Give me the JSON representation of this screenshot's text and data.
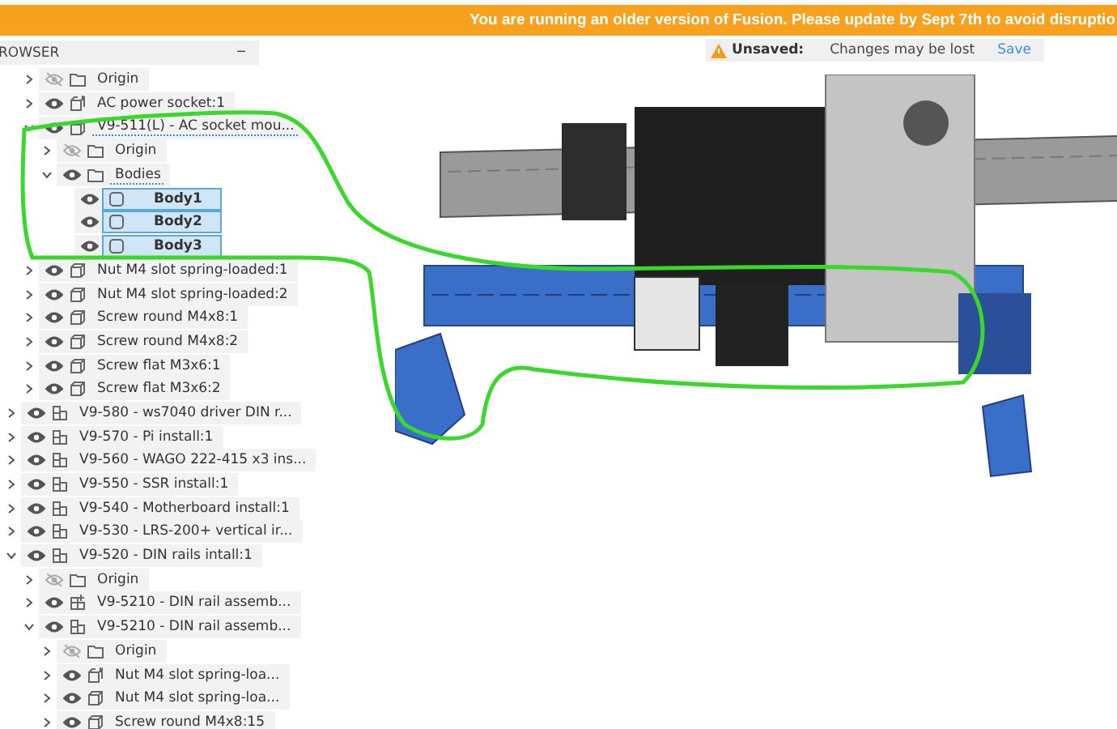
{
  "banner": {
    "text": "You are running an older version of Fusion. Please update by Sept 7th to avoid disruptio"
  },
  "save_status": {
    "label": "Unsaved:",
    "message": "Changes may be lost",
    "action": "Save"
  },
  "browser": {
    "title": "ROWSER",
    "collapse": "−",
    "nested_items": [
      {
        "label": "Origin",
        "kind": "folder",
        "visible": false,
        "expanded": false,
        "selected": false,
        "active": false
      },
      {
        "label": "AC power socket:1",
        "kind": "component-linked",
        "visible": true,
        "expanded": false,
        "selected": false,
        "active": false
      },
      {
        "label": "V9-511(L) - AC socket mou...",
        "kind": "component",
        "visible": true,
        "expanded": true,
        "selected": false,
        "active": true,
        "children": [
          {
            "label": "Origin",
            "kind": "folder",
            "visible": false,
            "expanded": false,
            "selected": false,
            "active": false
          },
          {
            "label": "Bodies",
            "kind": "folder",
            "visible": true,
            "expanded": true,
            "selected": false,
            "active": true,
            "children": [
              {
                "label": "Body1",
                "kind": "body",
                "visible": true,
                "selected": true,
                "active": false
              },
              {
                "label": "Body2",
                "kind": "body",
                "visible": true,
                "selected": true,
                "active": false
              },
              {
                "label": "Body3",
                "kind": "body",
                "visible": true,
                "selected": true,
                "active": false
              }
            ]
          }
        ]
      },
      {
        "label": "Nut M4 slot spring-loaded:1",
        "kind": "component",
        "visible": true,
        "expanded": false,
        "selected": false,
        "active": false
      },
      {
        "label": "Nut M4 slot spring-loaded:2",
        "kind": "component",
        "visible": true,
        "expanded": false,
        "selected": false,
        "active": false
      },
      {
        "label": "Screw round M4x8:1",
        "kind": "component",
        "visible": true,
        "expanded": false,
        "selected": false,
        "active": false
      },
      {
        "label": "Screw round M4x8:2",
        "kind": "component",
        "visible": true,
        "expanded": false,
        "selected": false,
        "active": false
      },
      {
        "label": "Screw flat M3x6:1",
        "kind": "component",
        "visible": true,
        "expanded": false,
        "selected": false,
        "active": false
      },
      {
        "label": "Screw flat M3x6:2",
        "kind": "component",
        "visible": true,
        "expanded": false,
        "selected": false,
        "active": false
      }
    ],
    "items": [
      {
        "label": "V9-580 - ws7040 driver DIN r...",
        "kind": "assembly",
        "visible": true,
        "expanded": false,
        "selected": false,
        "active": false
      },
      {
        "label": "V9-570 - Pi install:1",
        "kind": "assembly",
        "visible": true,
        "expanded": false,
        "selected": false,
        "active": false
      },
      {
        "label": "V9-560 - WAGO 222-415 x3 ins...",
        "kind": "assembly",
        "visible": true,
        "expanded": false,
        "selected": false,
        "active": false
      },
      {
        "label": "V9-550 - SSR install:1",
        "kind": "assembly",
        "visible": true,
        "expanded": false,
        "selected": false,
        "active": false
      },
      {
        "label": "V9-540 - Motherboard install:1",
        "kind": "assembly",
        "visible": true,
        "expanded": false,
        "selected": false,
        "active": false
      },
      {
        "label": "V9-530 - LRS-200+ vertical ir...",
        "kind": "assembly",
        "visible": true,
        "expanded": false,
        "selected": false,
        "active": false
      },
      {
        "label": "V9-520 - DIN rails intall:1",
        "kind": "assembly",
        "visible": true,
        "expanded": true,
        "selected": false,
        "active": false,
        "children": [
          {
            "label": "Origin",
            "kind": "folder",
            "visible": false,
            "expanded": false,
            "selected": false,
            "active": false
          },
          {
            "label": "V9-5210 - DIN rail assemb...",
            "kind": "assembly-linked",
            "visible": true,
            "expanded": false,
            "selected": false,
            "active": false
          },
          {
            "label": "V9-5210 - DIN rail assemb...",
            "kind": "assembly",
            "visible": true,
            "expanded": true,
            "selected": false,
            "active": false,
            "children": [
              {
                "label": "Origin",
                "kind": "folder",
                "visible": false,
                "expanded": false,
                "selected": false,
                "active": false
              },
              {
                "label": "Nut M4 slot spring-loa...",
                "kind": "component-linked",
                "visible": true,
                "expanded": false,
                "selected": false,
                "active": false
              },
              {
                "label": "Nut M4 slot spring-loa...",
                "kind": "component",
                "visible": true,
                "expanded": false,
                "selected": false,
                "active": false
              },
              {
                "label": "Screw round M4x8:15",
                "kind": "component",
                "visible": true,
                "expanded": false,
                "selected": false,
                "active": false
              }
            ]
          }
        ]
      }
    ]
  }
}
